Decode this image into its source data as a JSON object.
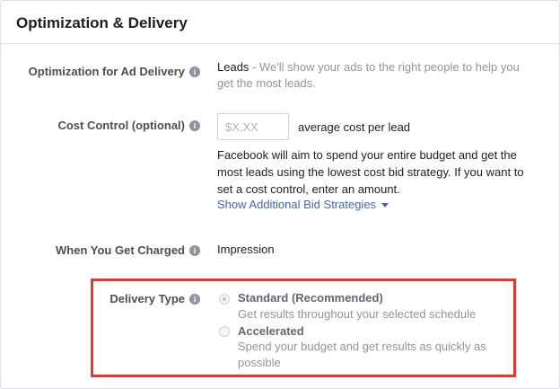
{
  "section": {
    "title": "Optimization & Delivery"
  },
  "optimization": {
    "label": "Optimization for Ad Delivery",
    "value": "Leads",
    "description": " - We'll show your ads to the right people to help you get the most leads."
  },
  "cost_control": {
    "label": "Cost Control (optional)",
    "placeholder": "$X.XX",
    "suffix": "average cost per lead",
    "help": "Facebook will aim to spend your entire budget and get the most leads using the lowest cost bid strategy. If you want to set a cost control, enter an amount.",
    "link": "Show Additional Bid Strategies"
  },
  "charged": {
    "label": "When You Get Charged",
    "value": "Impression"
  },
  "delivery_type": {
    "label": "Delivery Type",
    "options": [
      {
        "title": "Standard (Recommended)",
        "description": "Get results throughout your selected schedule",
        "selected": true
      },
      {
        "title": "Accelerated",
        "description": "Spend your budget and get results as quickly as possible",
        "selected": false
      }
    ]
  },
  "colors": {
    "link": "#4267b2",
    "highlight": "#e0392d"
  }
}
